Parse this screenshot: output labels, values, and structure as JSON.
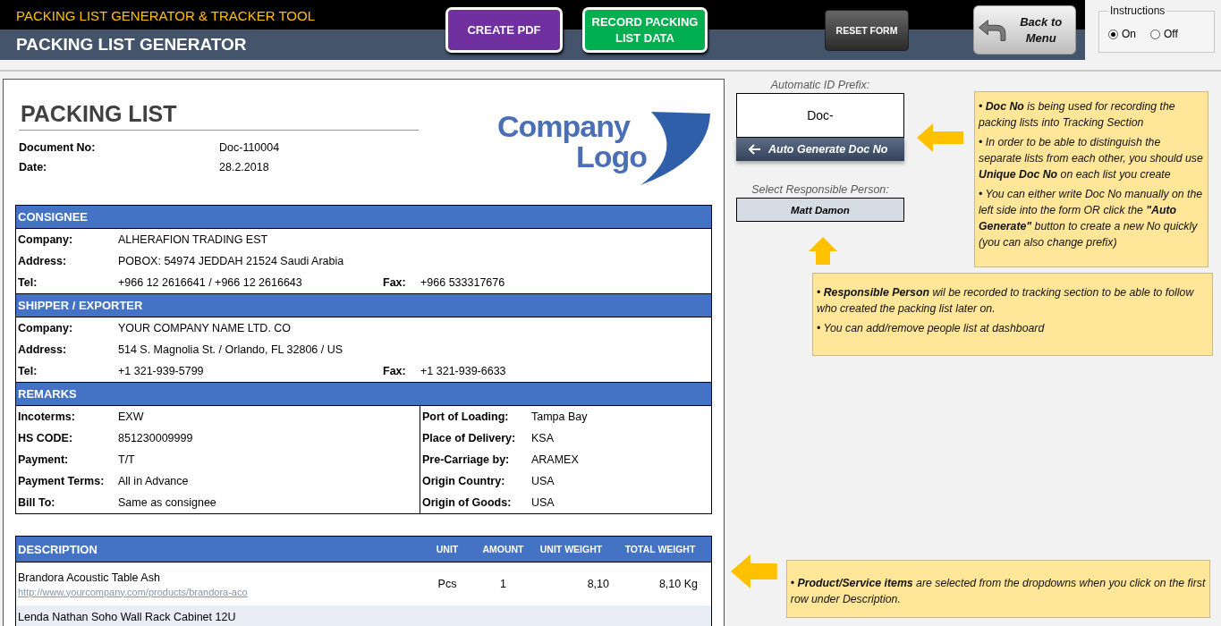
{
  "header": {
    "subtitle": "PACKING LIST GENERATOR & TRACKER TOOL",
    "title": "PACKING LIST GENERATOR",
    "buttons": [
      {
        "label": "CREATE PDF",
        "kind": "purple"
      },
      {
        "label": "RECORD PACKING LIST DATA",
        "kind": "green"
      },
      {
        "label": "RESET FORM",
        "kind": "dark"
      },
      {
        "label": "Back to Menu",
        "kind": "back"
      }
    ]
  },
  "instructions": {
    "title": "Instructions",
    "options": [
      {
        "label": "On",
        "selected": true
      },
      {
        "label": "Off",
        "selected": false
      }
    ]
  },
  "document": {
    "title": "PACKING LIST",
    "fields": [
      {
        "label": "Document No:",
        "value": "Doc-110004"
      },
      {
        "label": "Date:",
        "value": "28.2.2018"
      }
    ],
    "logo": [
      "Company",
      "Logo"
    ],
    "sections": [
      {
        "kind": "contact",
        "title": "CONSIGNEE",
        "rows": [
          {
            "label": "Company:",
            "value": "ALHERAFION TRADING EST"
          },
          {
            "label": "Address:",
            "value": "POBOX: 54974 JEDDAH 21524 Saudi Arabia"
          },
          {
            "label": "Tel:",
            "value": "+966 12 2616641 / +966 12 2616643",
            "label2": "Fax:",
            "value2": "+966 533317676"
          }
        ]
      },
      {
        "kind": "contact",
        "title": "SHIPPER / EXPORTER",
        "rows": [
          {
            "label": "Company:",
            "value": "YOUR COMPANY NAME LTD. CO"
          },
          {
            "label": "Address:",
            "value": "514 S. Magnolia St. / Orlando, FL 32806 / US"
          },
          {
            "label": "Tel:",
            "value": "+1 321-939-5799",
            "label2": "Fax:",
            "value2": "+1 321-939-6633"
          }
        ]
      },
      {
        "kind": "two_column",
        "title": "REMARKS",
        "left": [
          {
            "label": "Incoterms:",
            "value": "EXW"
          },
          {
            "label": "HS CODE:",
            "value": "851230009999"
          },
          {
            "label": "Payment:",
            "value": "T/T"
          },
          {
            "label": "Payment Terms:",
            "value": "All in Advance"
          },
          {
            "label": "Bill To:",
            "value": "Same as consignee"
          }
        ],
        "right": [
          {
            "label": "Port of Loading:",
            "value": "Tampa Bay"
          },
          {
            "label": "Place of Delivery:",
            "value": "KSA"
          },
          {
            "label": "Pre-Carriage by:",
            "value": "ARAMEX"
          },
          {
            "label": "Origin Country:",
            "value": "USA"
          },
          {
            "label": "Origin of Goods:",
            "value": "USA"
          }
        ]
      }
    ],
    "items": {
      "columns": [
        "DESCRIPTION",
        "UNIT",
        "AMOUNT",
        "UNIT WEIGHT",
        "TOTAL WEIGHT"
      ],
      "rows": [
        {
          "name": "Brandora Acoustic Table Ash",
          "link": "http://www.yourcompany.com/products/brandora-aco",
          "unit": "Pcs",
          "amount": "1",
          "unit_weight": "8,10",
          "total_weight": "8,10",
          "weight_unit": "Kg"
        },
        {
          "name": "Lenda Nathan Soho Wall Rack Cabinet 12U"
        }
      ]
    }
  },
  "side": {
    "prefix": {
      "label": "Automatic ID Prefix:",
      "value": "Doc-",
      "button": "Auto Generate Doc No"
    },
    "person": {
      "label": "Select Responsible Person:",
      "value": "Matt Damon"
    },
    "notes": [
      [
        "• **Doc No** is being used for recording the packing lists into Tracking Section",
        "• In order to be able to distinguish the separate lists from each other, you should use **Unique Doc No** on each list you create",
        "• You can either write Doc No manually on the left side into the form OR click the **\"Auto Generate\"** button to create a new No quickly (you can also change prefix)"
      ],
      [
        "• **Responsible Person** wil be recorded to tracking section to be able to follow who created the packing list later on.",
        "• You can add/remove people list at dashboard"
      ],
      [
        "• **Product/Service items** are selected from the dropdowns when you click on the first row under Description."
      ]
    ]
  }
}
